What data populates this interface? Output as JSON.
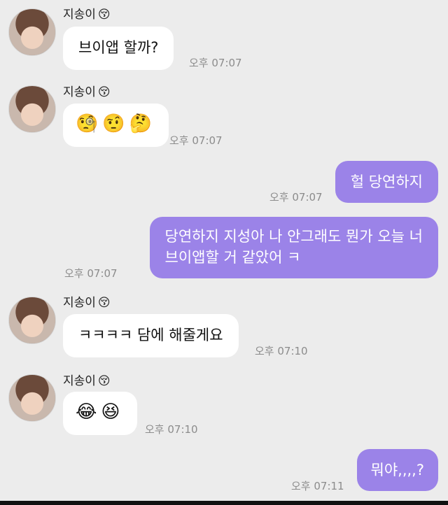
{
  "messages": [
    {
      "sender": "지송이",
      "sender_emoji": "😚",
      "text": "브이앱 할까?",
      "time": "오후 07:07"
    },
    {
      "sender": "지송이",
      "sender_emoji": "😚",
      "emojis": [
        "🧐",
        "🤨",
        "🤔"
      ],
      "time": "오후 07:07"
    },
    {
      "text": "헐 당연하지",
      "time": "오후 07:07"
    },
    {
      "text_line1": "당연하지 지성아 나 안그래도 뭔가 오늘 너",
      "text_line2": "브이앱할 거 같았어 ㅋ",
      "time": "오후 07:07"
    },
    {
      "sender": "지송이",
      "sender_emoji": "😚",
      "text": "ㅋㅋㅋㅋ 담에 해줄게요",
      "time": "오후 07:10"
    },
    {
      "sender": "지송이",
      "sender_emoji": "😚",
      "emojis": [
        "😂",
        "😆"
      ],
      "time": "오후 07:10"
    },
    {
      "text": "뭐야,,,,?",
      "time": "오후 07:11"
    }
  ],
  "colors": {
    "background": "#ececec",
    "incoming_bubble": "#ffffff",
    "outgoing_bubble": "#9b83e8"
  }
}
